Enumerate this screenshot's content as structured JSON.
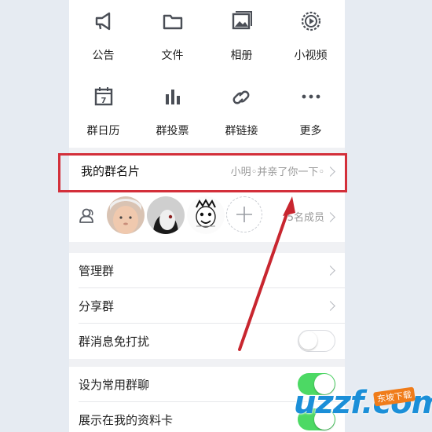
{
  "grid": [
    {
      "label": "公告",
      "icon": "megaphone-icon"
    },
    {
      "label": "文件",
      "icon": "folder-icon"
    },
    {
      "label": "相册",
      "icon": "photo-album-icon"
    },
    {
      "label": "小视频",
      "icon": "short-video-icon"
    },
    {
      "label": "群日历",
      "icon": "calendar-icon",
      "icon_text": "7"
    },
    {
      "label": "群投票",
      "icon": "bar-chart-icon"
    },
    {
      "label": "群链接",
      "icon": "link-icon"
    },
    {
      "label": "更多",
      "icon": "more-dots-icon"
    }
  ],
  "namecard": {
    "label": "我的群名片",
    "value": "小明◦并亲了你一下◦"
  },
  "members": {
    "count_text": "5名成员",
    "icon": "members-icon"
  },
  "settings": [
    {
      "label": "管理群",
      "control": "chevron"
    },
    {
      "label": "分享群",
      "control": "chevron"
    },
    {
      "label": "群消息免打扰",
      "control": "toggle",
      "on": false
    },
    {
      "label": "设为常用群聊",
      "control": "toggle",
      "on": true
    },
    {
      "label": "展示在我的资料卡",
      "control": "toggle",
      "on": true
    }
  ],
  "watermark": {
    "text": "uzzf.com",
    "badge": "东坡下载"
  },
  "colors": {
    "highlight": "#d32f3a",
    "toggle_on": "#4cd964",
    "icon": "#4a4e56"
  }
}
